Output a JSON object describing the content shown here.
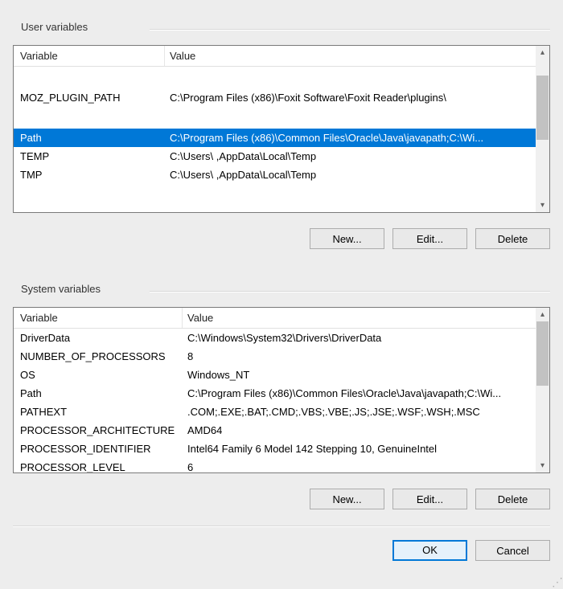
{
  "user_section": {
    "label": "User variables",
    "columns": {
      "variable": "Variable",
      "value": "Value"
    },
    "rows": [
      {
        "name": "MOZ_PLUGIN_PATH",
        "value": "C:\\Program Files (x86)\\Foxit Software\\Foxit Reader\\plugins\\",
        "tall": true
      },
      {
        "name": "Path",
        "value": "C:\\Program Files (x86)\\Common Files\\Oracle\\Java\\javapath;C:\\Wi...",
        "selected": true
      },
      {
        "name": "TEMP",
        "value": "C:\\Users\\          ,AppData\\Local\\Temp"
      },
      {
        "name": "TMP",
        "value": "C:\\Users\\          ,AppData\\Local\\Temp"
      }
    ],
    "buttons": {
      "new": "New...",
      "edit": "Edit...",
      "delete": "Delete"
    }
  },
  "system_section": {
    "label": "System variables",
    "columns": {
      "variable": "Variable",
      "value": "Value"
    },
    "rows": [
      {
        "name": "DriverData",
        "value": "C:\\Windows\\System32\\Drivers\\DriverData"
      },
      {
        "name": "NUMBER_OF_PROCESSORS",
        "value": "8"
      },
      {
        "name": "OS",
        "value": "Windows_NT"
      },
      {
        "name": "Path",
        "value": "C:\\Program Files (x86)\\Common Files\\Oracle\\Java\\javapath;C:\\Wi..."
      },
      {
        "name": "PATHEXT",
        "value": ".COM;.EXE;.BAT;.CMD;.VBS;.VBE;.JS;.JSE;.WSF;.WSH;.MSC"
      },
      {
        "name": "PROCESSOR_ARCHITECTURE",
        "value": "AMD64"
      },
      {
        "name": "PROCESSOR_IDENTIFIER",
        "value": "Intel64 Family 6 Model 142 Stepping 10, GenuineIntel"
      },
      {
        "name": "PROCESSOR_LEVEL",
        "value": "6"
      }
    ],
    "buttons": {
      "new": "New...",
      "edit": "Edit...",
      "delete": "Delete"
    }
  },
  "dialog_buttons": {
    "ok": "OK",
    "cancel": "Cancel"
  }
}
